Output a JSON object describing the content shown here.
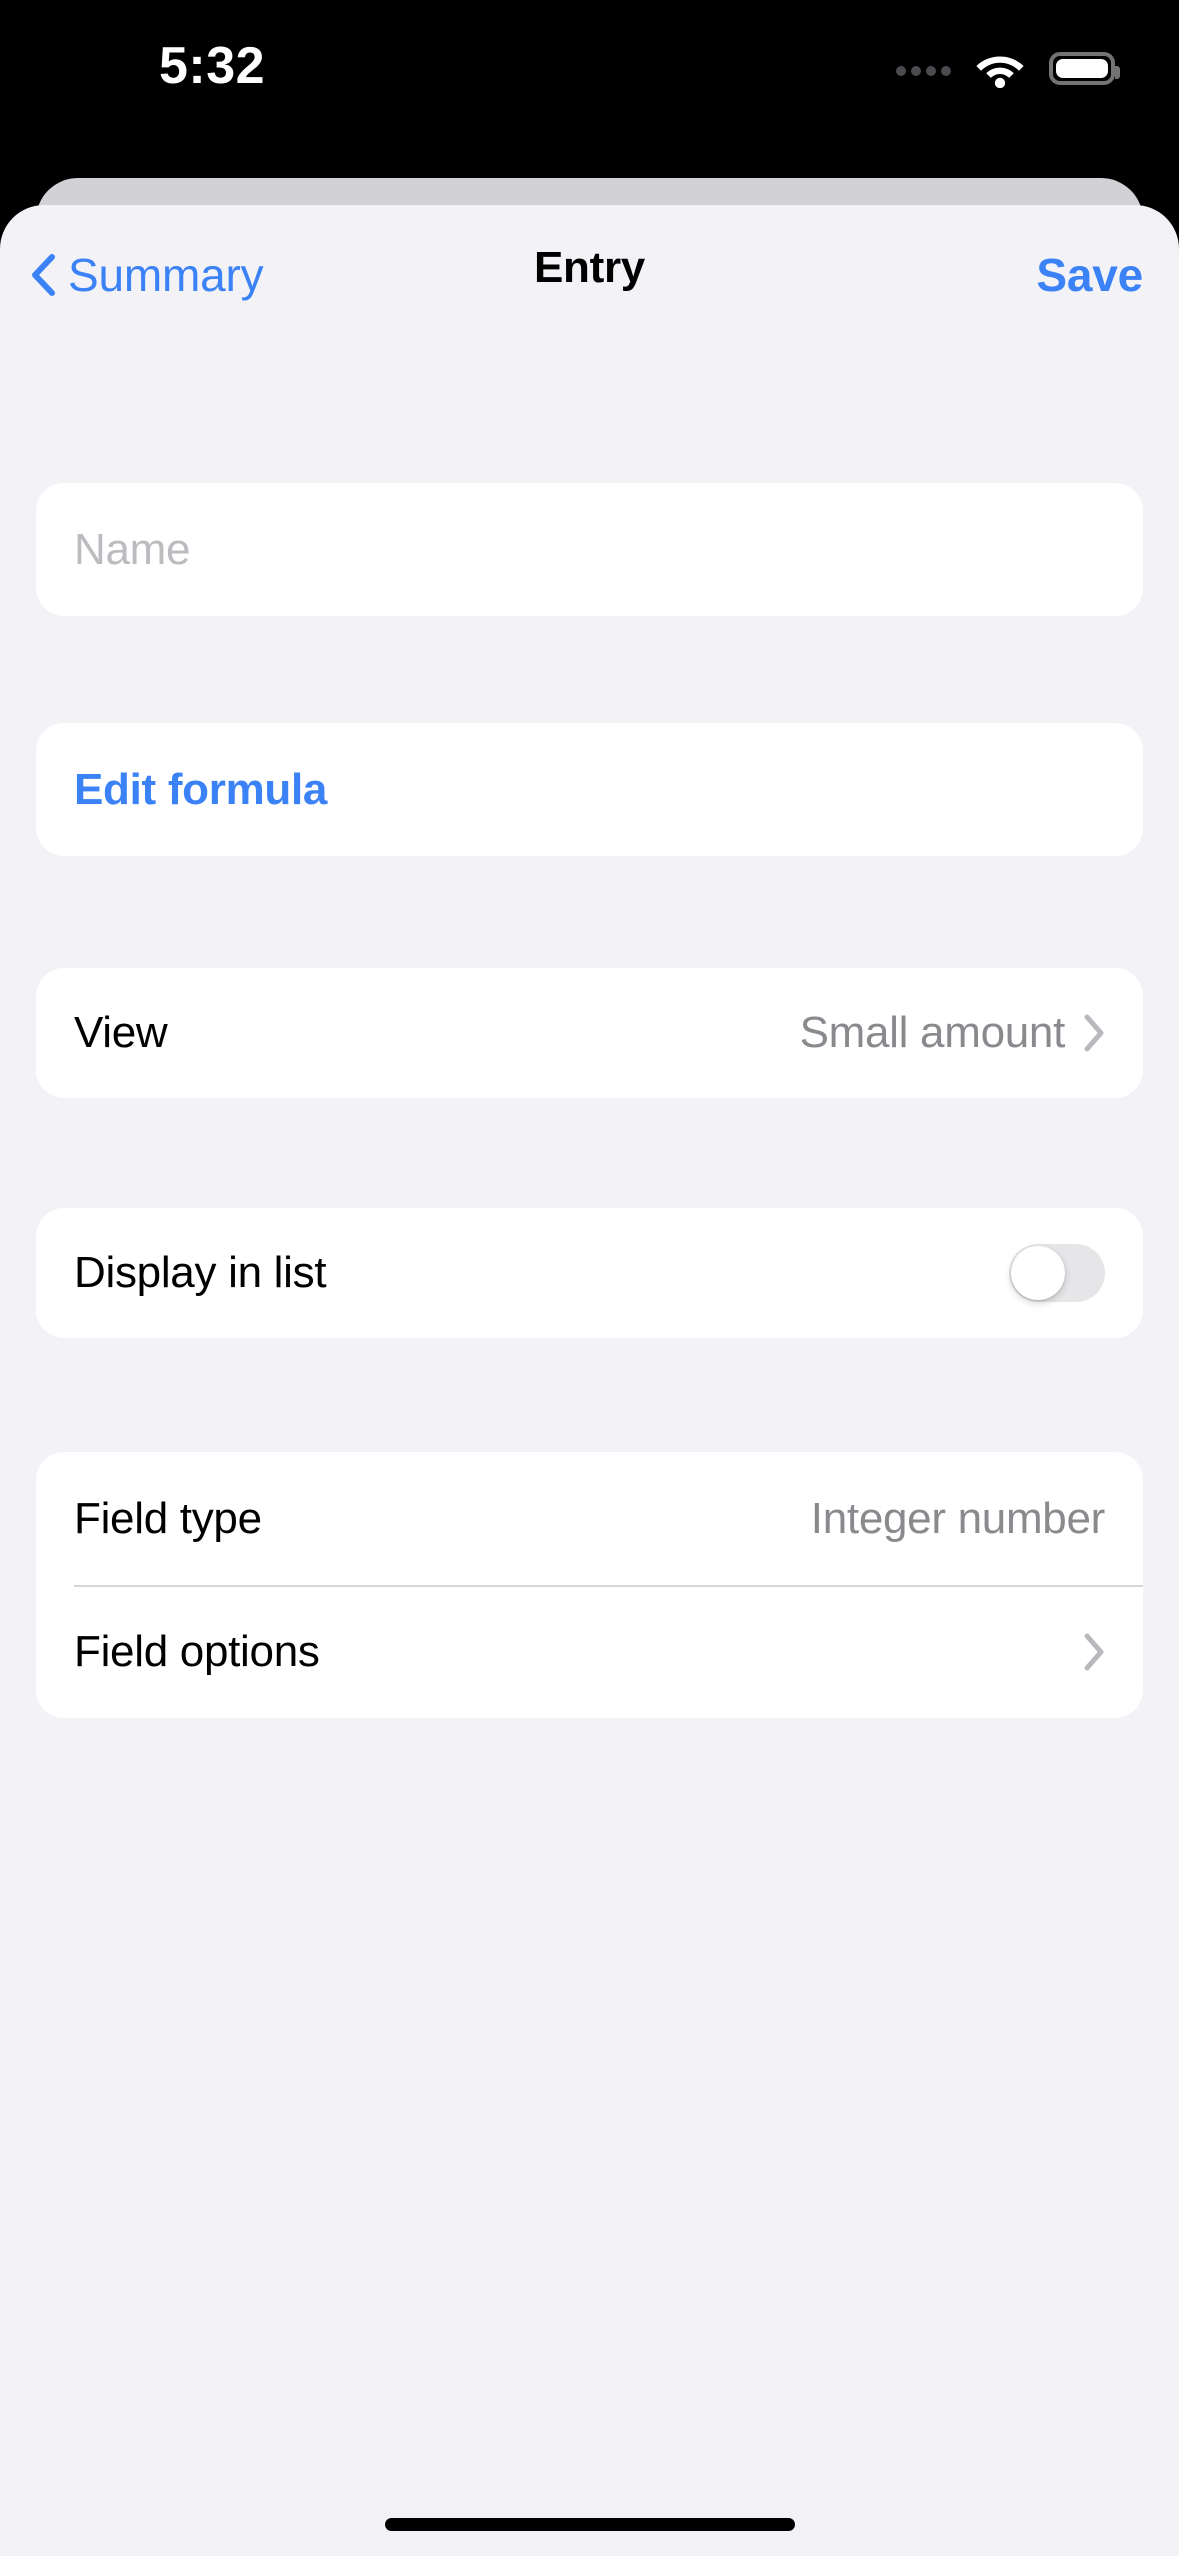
{
  "status_bar": {
    "time": "5:32",
    "cellular_icon": "cellular-dots-icon",
    "wifi_icon": "wifi-icon",
    "battery_icon": "battery-full-icon"
  },
  "nav": {
    "back_icon": "chevron-left-icon",
    "back_label": "Summary",
    "title": "Entry",
    "save_label": "Save"
  },
  "form": {
    "name_field": {
      "placeholder": "Name",
      "value": ""
    },
    "edit_formula": {
      "label": "Edit formula"
    },
    "view": {
      "label": "View",
      "value": "Small amount",
      "disclosure_icon": "chevron-right-icon"
    },
    "display_in_list": {
      "label": "Display in list",
      "toggle_state": "off"
    },
    "field_type": {
      "label": "Field type",
      "value": "Integer number"
    },
    "field_options": {
      "label": "Field options",
      "disclosure_icon": "chevron-right-icon"
    }
  },
  "colors": {
    "accent": "#3b82f6",
    "background": "#f2f2f7",
    "card": "#ffffff",
    "secondary_text": "#8a8a8e",
    "placeholder_text": "#bcbcc0",
    "toggle_off_track": "#e6e6e9"
  },
  "home_indicator": "home-indicator"
}
